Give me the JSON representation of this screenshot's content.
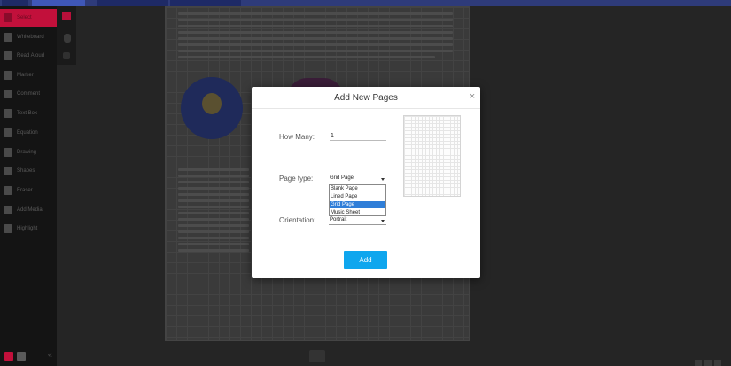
{
  "sidebar": {
    "items": [
      {
        "label": "Select",
        "icon": "cursor-icon"
      },
      {
        "label": "Whiteboard",
        "icon": "board-icon"
      },
      {
        "label": "Read Aloud",
        "icon": "speaker-icon"
      },
      {
        "label": "Marker",
        "icon": "marker-icon"
      },
      {
        "label": "Comment",
        "icon": "comment-icon"
      },
      {
        "label": "Text Box",
        "icon": "textbox-icon"
      },
      {
        "label": "Equation",
        "icon": "equation-icon"
      },
      {
        "label": "Drawing",
        "icon": "pencil-icon"
      },
      {
        "label": "Shapes",
        "icon": "shapes-icon"
      },
      {
        "label": "Eraser",
        "icon": "eraser-icon"
      },
      {
        "label": "Add Media",
        "icon": "media-icon"
      },
      {
        "label": "Highlight",
        "icon": "highlight-icon"
      }
    ],
    "active_index": 0,
    "accent_color": "#c2103b"
  },
  "dialog": {
    "title": "Add New Pages",
    "close_glyph": "×",
    "how_many_label": "How Many:",
    "how_many_value": "1",
    "page_type_label": "Page type:",
    "page_type_selected": "Grid Page",
    "page_type_options": [
      "Blank Page",
      "Lined Page",
      "Grid Page",
      "Music Sheet"
    ],
    "page_type_highlight_index": 2,
    "orientation_label": "Orientation:",
    "orientation_selected": "Portrait",
    "add_label": "Add",
    "add_color": "#0fa6ee",
    "highlight_color": "#2f7ed8"
  }
}
